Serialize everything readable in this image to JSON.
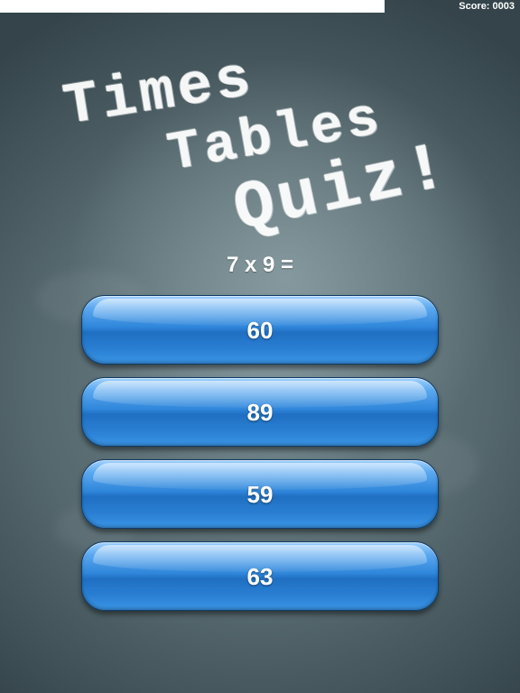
{
  "progress": {
    "fraction": 0.74,
    "color": "#ffffff"
  },
  "score": {
    "label": "Score: 0003"
  },
  "title": {
    "line1": "Times",
    "line2": "Tables",
    "line3": "Quiz!"
  },
  "question": {
    "text": "7 x 9 ="
  },
  "answers": [
    {
      "label": "60"
    },
    {
      "label": "89"
    },
    {
      "label": "59"
    },
    {
      "label": "63"
    }
  ],
  "colors": {
    "button_blue": "#2f86da",
    "background": "#55686e",
    "text": "#ffffff"
  }
}
